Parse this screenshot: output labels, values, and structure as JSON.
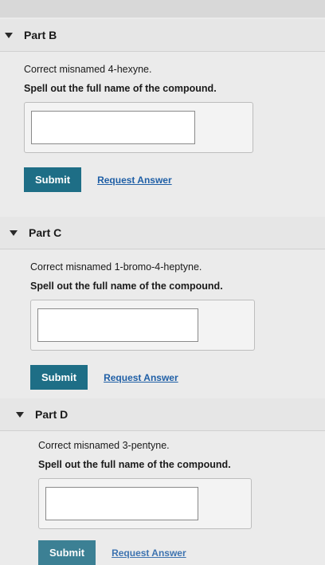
{
  "parts": [
    {
      "title": "Part B",
      "question": "Correct misnamed 4-hexyne.",
      "instruction": "Spell out the full name of the compound.",
      "answer_value": "",
      "submit_label": "Submit",
      "request_label": "Request Answer"
    },
    {
      "title": "Part C",
      "question": "Correct misnamed 1-bromo-4-heptyne.",
      "instruction": "Spell out the full name of the compound.",
      "answer_value": "",
      "submit_label": "Submit",
      "request_label": "Request Answer"
    },
    {
      "title": "Part D",
      "question": "Correct misnamed 3-pentyne.",
      "instruction": "Spell out the full name of the compound.",
      "answer_value": "",
      "submit_label": "Submit",
      "request_label": "Request Answer"
    }
  ],
  "icons": {
    "collapse": "chevron-down-icon"
  },
  "colors": {
    "submit_bg": "#1e6e86",
    "link": "#1f5fa6"
  }
}
